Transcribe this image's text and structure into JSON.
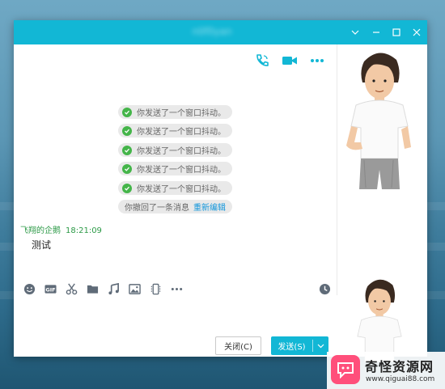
{
  "window": {
    "title": "n0f0yan",
    "controls": [
      "chevron-down-icon",
      "minimize-icon",
      "maximize-icon",
      "close-icon"
    ]
  },
  "top_toolbar": [
    "phone-call-icon",
    "video-call-icon",
    "more-icon"
  ],
  "notices": [
    {
      "text": "你发送了一个窗口抖动。"
    },
    {
      "text": "你发送了一个窗口抖动。"
    },
    {
      "text": "你发送了一个窗口抖动。"
    },
    {
      "text": "你发送了一个窗口抖动。"
    },
    {
      "text": "你发送了一个窗口抖动。"
    }
  ],
  "recall_notice": {
    "text": "你撤回了一条消息",
    "link": "重新编辑"
  },
  "message": {
    "sender": "飞翔的企鹅",
    "time": "18:21:09",
    "text": "测试"
  },
  "input_toolbar": [
    "emoji-icon",
    "gif-icon",
    "scissors-icon",
    "folder-icon",
    "music-icon",
    "image-icon",
    "shake-icon",
    "more-icon",
    "history-icon"
  ],
  "buttons": {
    "close": "关闭(C)",
    "send": "发送(S)"
  },
  "watermark": {
    "title": "奇怪资源网",
    "url": "www.qiguai88.com"
  },
  "colors": {
    "accent": "#12b7d5",
    "check": "#44b549",
    "sender": "#2c9a47",
    "link": "#1296db"
  }
}
